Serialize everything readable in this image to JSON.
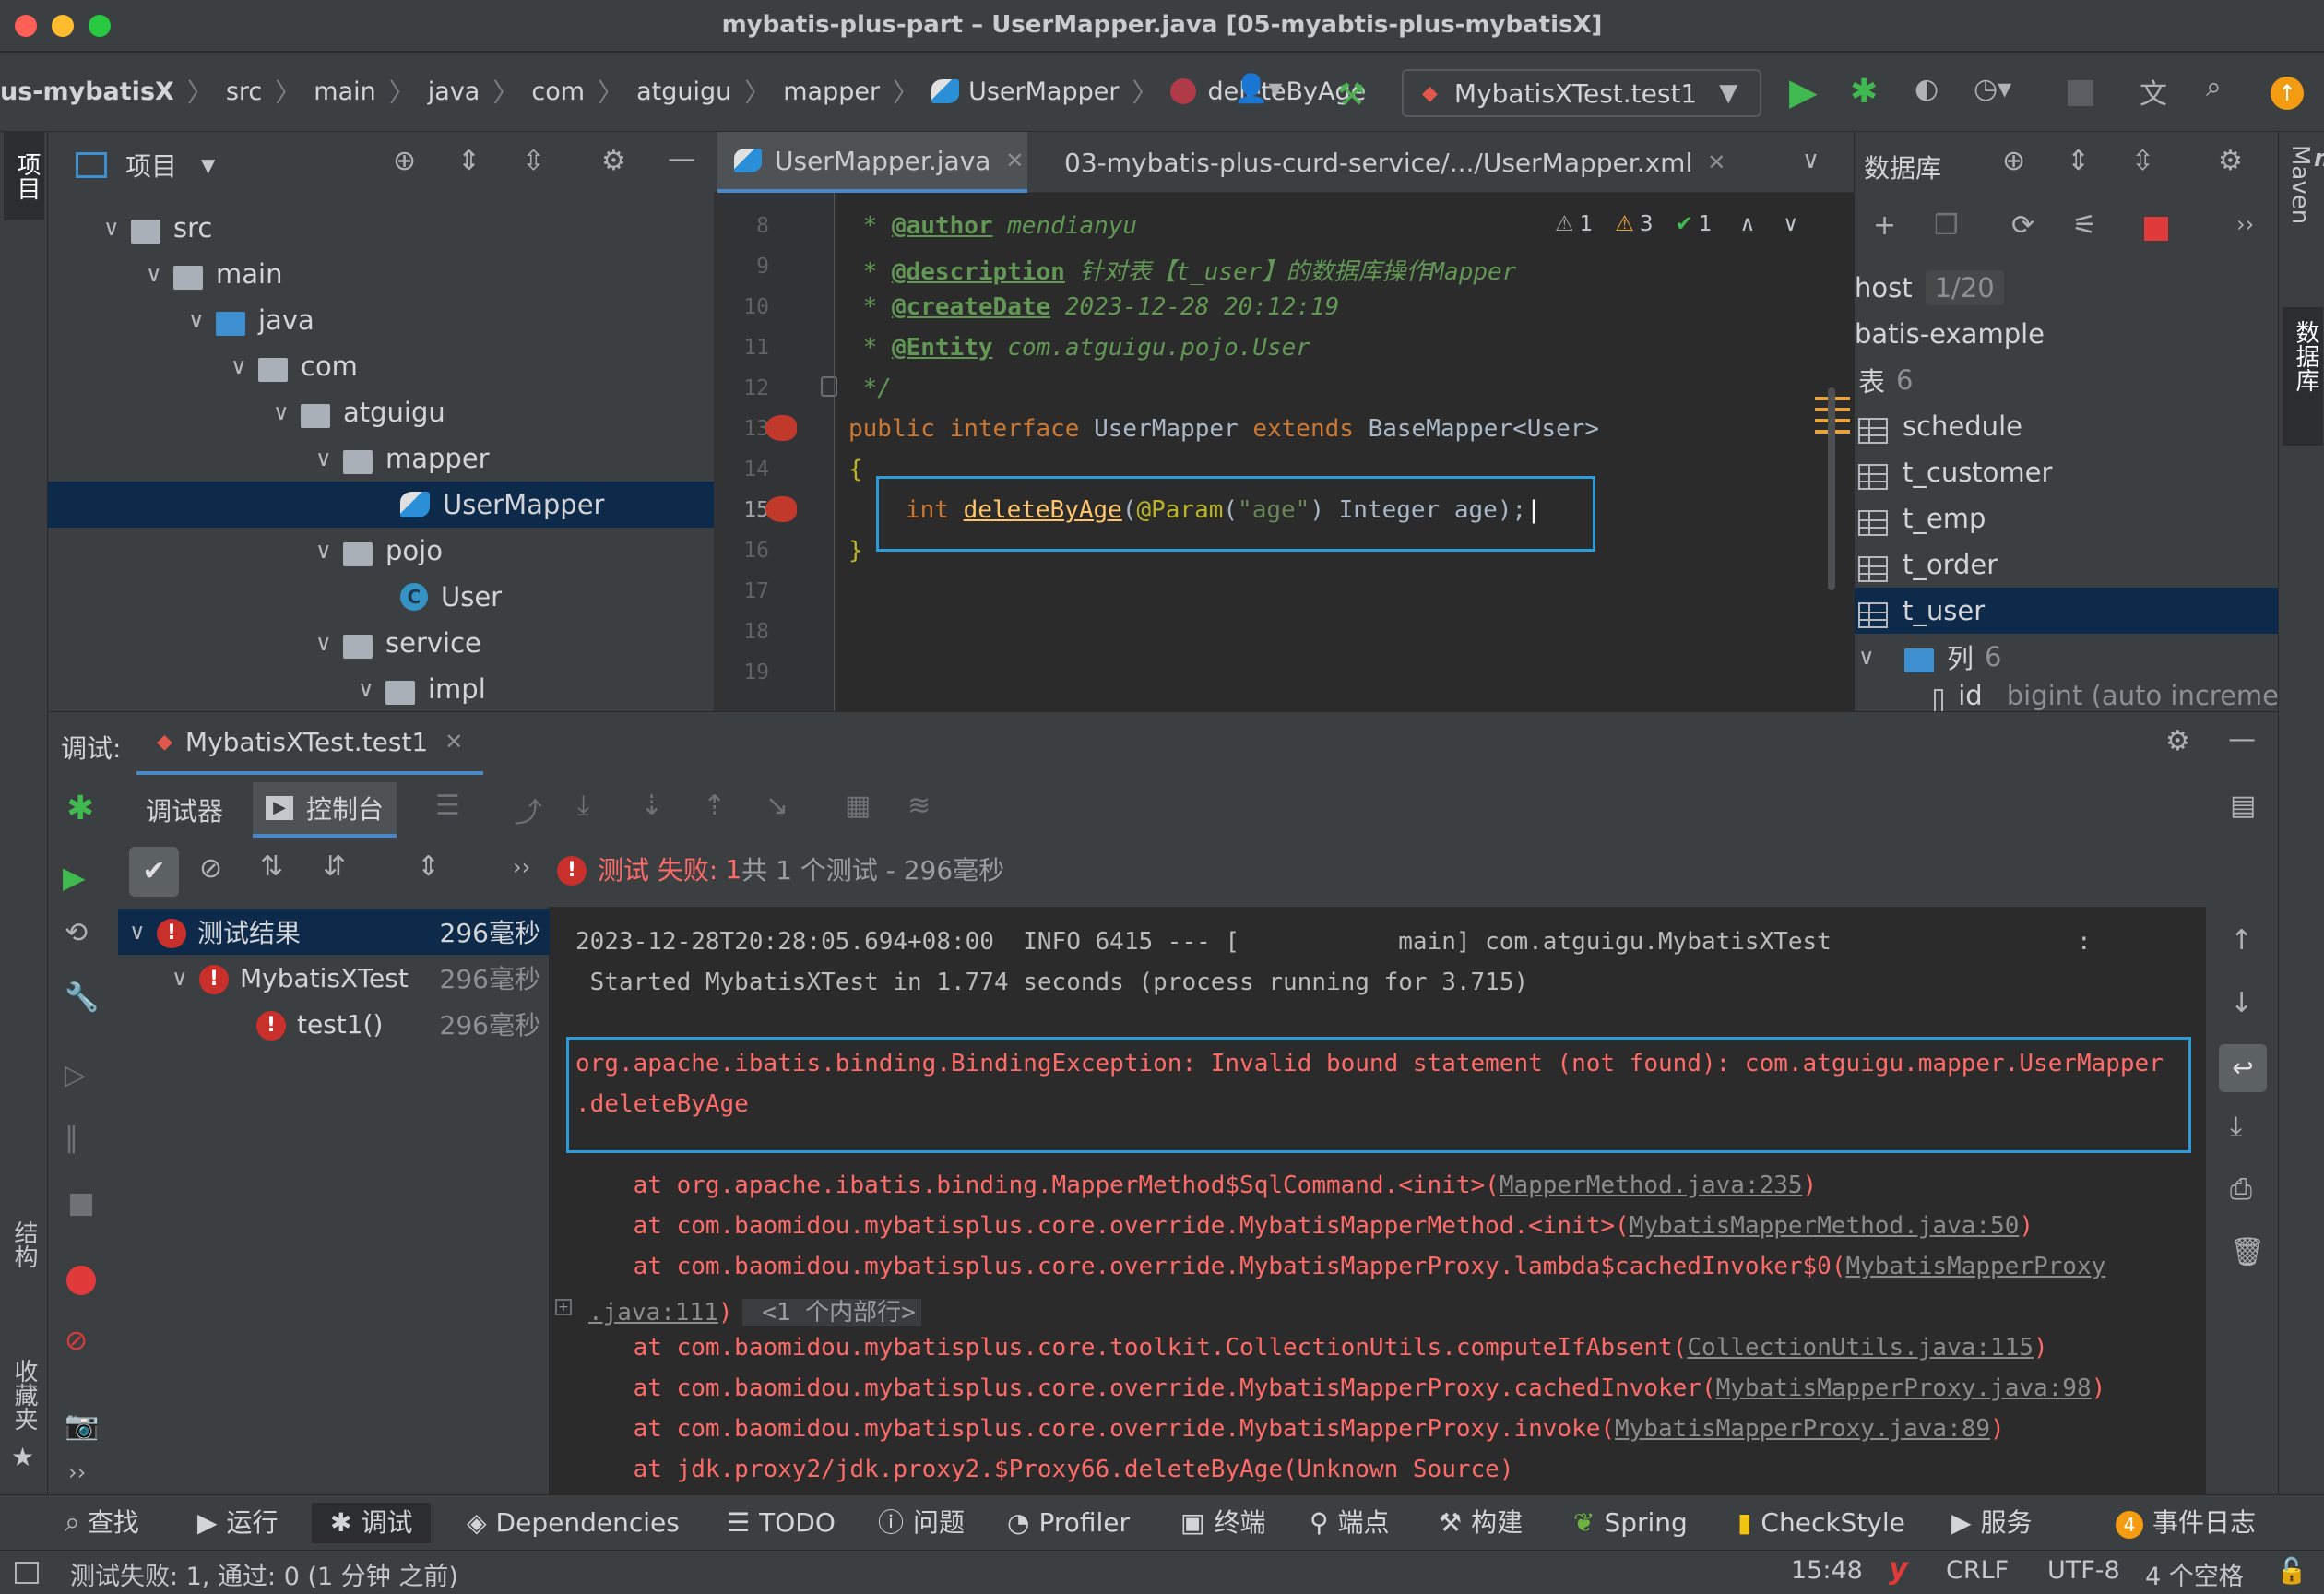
{
  "window": {
    "title": "mybatis-plus-part – UserMapper.java [05-myabtis-plus-mybatisX]"
  },
  "breadcrumb": [
    "us-mybatisX",
    "src",
    "main",
    "java",
    "com",
    "atguigu",
    "mapper",
    "UserMapper",
    "deleteByAge"
  ],
  "run_config": "MybatisXTest.test1",
  "project_panel": {
    "title": "项目",
    "tree": [
      {
        "label": "src",
        "depth": 1
      },
      {
        "label": "main",
        "depth": 2
      },
      {
        "label": "java",
        "depth": 3
      },
      {
        "label": "com",
        "depth": 4
      },
      {
        "label": "atguigu",
        "depth": 5
      },
      {
        "label": "mapper",
        "depth": 6
      },
      {
        "label": "UserMapper",
        "depth": 7
      },
      {
        "label": "pojo",
        "depth": 6
      },
      {
        "label": "User",
        "depth": 7
      },
      {
        "label": "service",
        "depth": 6
      },
      {
        "label": "impl",
        "depth": 7
      }
    ]
  },
  "editor": {
    "tabs": [
      {
        "label": "UserMapper.java"
      },
      {
        "label": "03-mybatis-plus-curd-service/.../UserMapper.xml"
      }
    ],
    "inspections": {
      "warn1": "1",
      "warn2": "3",
      "ok": "1"
    },
    "lines": [
      "8",
      "9",
      "10",
      "11",
      "12",
      "13",
      "14",
      "15",
      "16",
      "17",
      "18",
      "19"
    ],
    "code": {
      "l8_tag": "@author",
      "l8_val": " mendianyu",
      "l9_tag": "@description",
      "l9_val": " 针对表【t_user】的数据库操作Mapper",
      "l10_tag": "@createDate",
      "l10_val": " 2023-12-28 20:12:19",
      "l11_tag": "@Entity",
      "l11_val": " com.atguigu.pojo.User",
      "l12": " */",
      "l13_kw1": "public",
      "l13_kw2": "interface",
      "l13_name": "UserMapper",
      "l13_kw3": "extends",
      "l13_base": "BaseMapper",
      "l13_gen": "<User>",
      "l14": "{",
      "l15_kw": "int",
      "l15_fn": "deleteByAge",
      "l15_ann": "@Param",
      "l15_str": "\"age\"",
      "l15_rest": " Integer age);",
      "l16": "}"
    }
  },
  "database_panel": {
    "title": "数据库",
    "host_label": "host",
    "host_count": "1/20",
    "schema": "batis-example",
    "tables_label": "表",
    "tables_count": "6",
    "tables": [
      "schedule",
      "t_customer",
      "t_emp",
      "t_order",
      "t_user"
    ],
    "columns_label": "列",
    "columns_count": "6",
    "column_id": "id",
    "column_id_type": "bigint (auto increme"
  },
  "debug": {
    "label": "调试:",
    "session_tab": "MybatisXTest.test1",
    "sub_tabs": [
      "调试器",
      "控制台"
    ],
    "summary_prefix": "测试 失败:",
    "summary_count": "1",
    "summary_rest": "共 1 个测试 - 296毫秒",
    "results": [
      {
        "label": "测试结果",
        "time": "296毫秒"
      },
      {
        "label": "MybatisXTest",
        "time": "296毫秒"
      },
      {
        "label": "test1()",
        "time": "296毫秒"
      }
    ],
    "console": [
      "2023-12-28T20:28:05.694+08:00  INFO 6415 --- [           main] com.atguigu.MybatisXTest                 :",
      " Started MybatisXTest in 1.774 seconds (process running for 3.715)"
    ],
    "exception_1": "org.apache.ibatis.binding.BindingException: Invalid bound statement (not found): com.atguigu.mapper.UserMapper",
    "exception_2": ".deleteByAge",
    "stack": [
      {
        "text": "    at org.apache.ibatis.binding.MapperMethod$SqlCommand.<init>(",
        "link": "MapperMethod.java:235",
        "end": ")"
      },
      {
        "text": "    at com.baomidou.mybatisplus.core.override.MybatisMapperMethod.<init>(",
        "link": "MybatisMapperMethod.java:50",
        "end": ")"
      },
      {
        "text": "    at com.baomidou.mybatisplus.core.override.MybatisMapperProxy.lambda$cachedInvoker$0(",
        "link": "MybatisMapperProxy",
        "end": ""
      },
      {
        "text": "",
        "link": ".java:111",
        "end": ")",
        "fold": " <1 个内部行>"
      },
      {
        "text": "    at com.baomidou.mybatisplus.core.toolkit.CollectionUtils.computeIfAbsent(",
        "link": "CollectionUtils.java:115",
        "end": ")"
      },
      {
        "text": "    at com.baomidou.mybatisplus.core.override.MybatisMapperProxy.cachedInvoker(",
        "link": "MybatisMapperProxy.java:98",
        "end": ")"
      },
      {
        "text": "    at com.baomidou.mybatisplus.core.override.MybatisMapperProxy.invoke(",
        "link": "MybatisMapperProxy.java:89",
        "end": ")"
      },
      {
        "text": "    at jdk.proxy2/jdk.proxy2.$Proxy66.deleteByAge(Unknown Source)",
        "link": "",
        "end": ""
      }
    ]
  },
  "tool_windows": [
    "查找",
    "运行",
    "调试",
    "Dependencies",
    "TODO",
    "问题",
    "Profiler",
    "终端",
    "端点",
    "构建",
    "Spring",
    "CheckStyle",
    "服务",
    "事件日志"
  ],
  "event_log_count": "4",
  "side_labels": {
    "left_top": "项目",
    "left_mid": "结构",
    "left_bottom": "收藏夹",
    "right_top": "Maven",
    "right_mid": "数据库"
  },
  "status_bar": {
    "message": "测试失败: 1, 通过: 0 (1 分钟 之前)",
    "position": "15:48",
    "line_sep": "CRLF",
    "encoding": "UTF-8",
    "indent": "4 个空格"
  },
  "colors": {
    "accent": "#2f9bd6",
    "error": "#ff6b68",
    "selection": "#0d2a4a",
    "run": "#3fb950"
  }
}
